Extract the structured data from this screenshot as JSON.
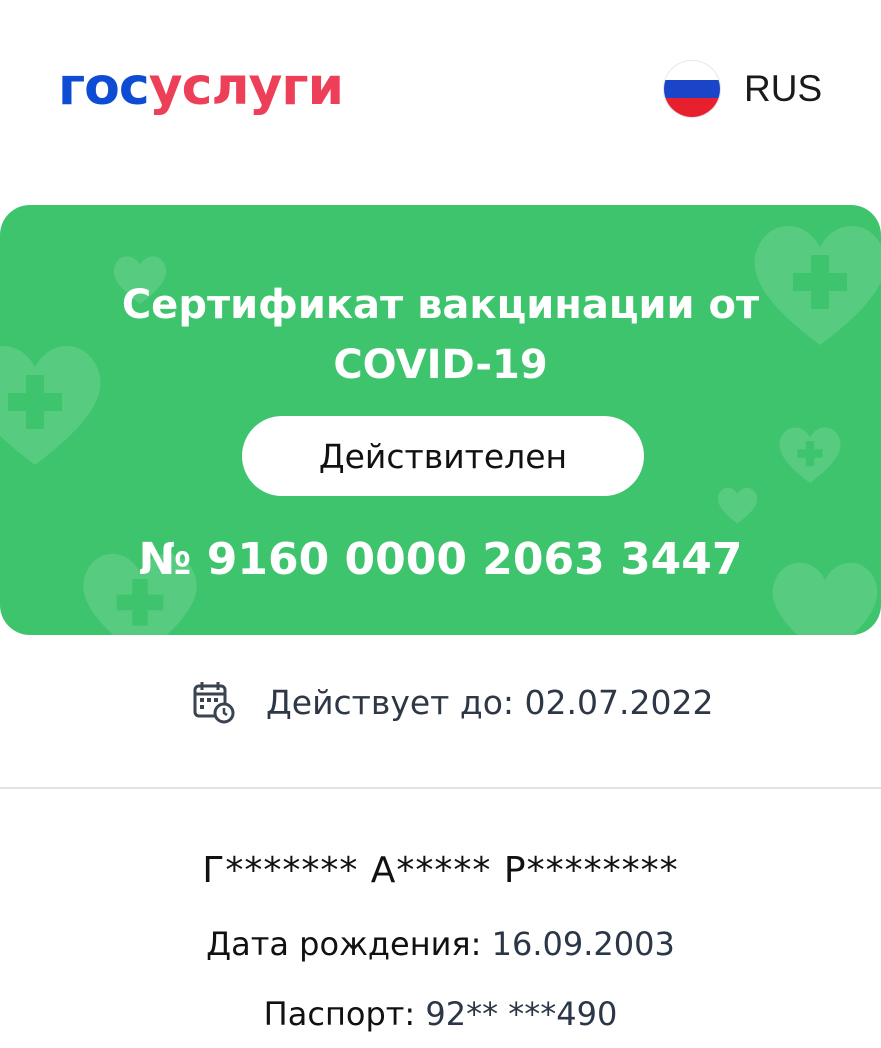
{
  "header": {
    "logo_part1": "гос",
    "logo_part2": "услуги",
    "language_code": "RUS",
    "language_flag_icon": "russia-flag-icon"
  },
  "certificate": {
    "title_line1": "Сертификат вакцинации от",
    "title_line2": "COVID-19",
    "status": "Действителен",
    "number": "№ 9160 0000 2063 3447",
    "card_color": "#3ec46d"
  },
  "validity": {
    "icon": "calendar-clock-icon",
    "text": "Действует до: 02.07.2022"
  },
  "person": {
    "name": "Г******* А***** Р********",
    "birth_label": "Дата рождения:",
    "birth_value": "16.09.2003",
    "passport_label": "Паспорт:",
    "passport_value": "92** ***490"
  },
  "colors": {
    "brand_blue": "#0d4cd3",
    "brand_red": "#ee3f58",
    "accent_green": "#3ec46d"
  }
}
